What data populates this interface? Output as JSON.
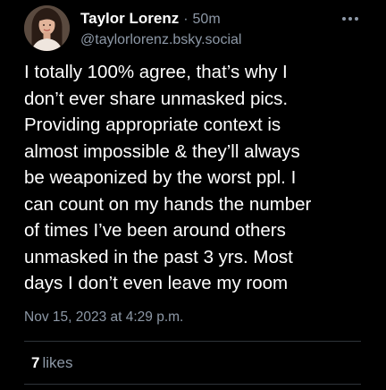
{
  "post": {
    "author": {
      "display_name": "Taylor Lorenz",
      "time_ago": "50m",
      "handle": "@taylorlorenz.bsky.social",
      "avatar_icon": "profile-photo"
    },
    "more_icon": "ellipsis-icon",
    "body_lines": [
      "I totally 100% agree, that’s why I",
      "don’t ever share unmasked pics.",
      "Providing appropriate context is",
      "almost impossible & they’ll always",
      "be weaponized by the worst ppl. I",
      "can count on my hands the number",
      "of times I’ve been around others",
      "unmasked in the past 3 yrs. Most",
      "days I don’t even leave my room"
    ],
    "timestamp": "Nov 15, 2023 at 4:29 p.m.",
    "likes": {
      "count": "7",
      "label": "likes"
    }
  },
  "colors": {
    "background": "#000000",
    "text": "#ffffff",
    "muted": "#8d98a6",
    "divider": "#2e3439"
  }
}
